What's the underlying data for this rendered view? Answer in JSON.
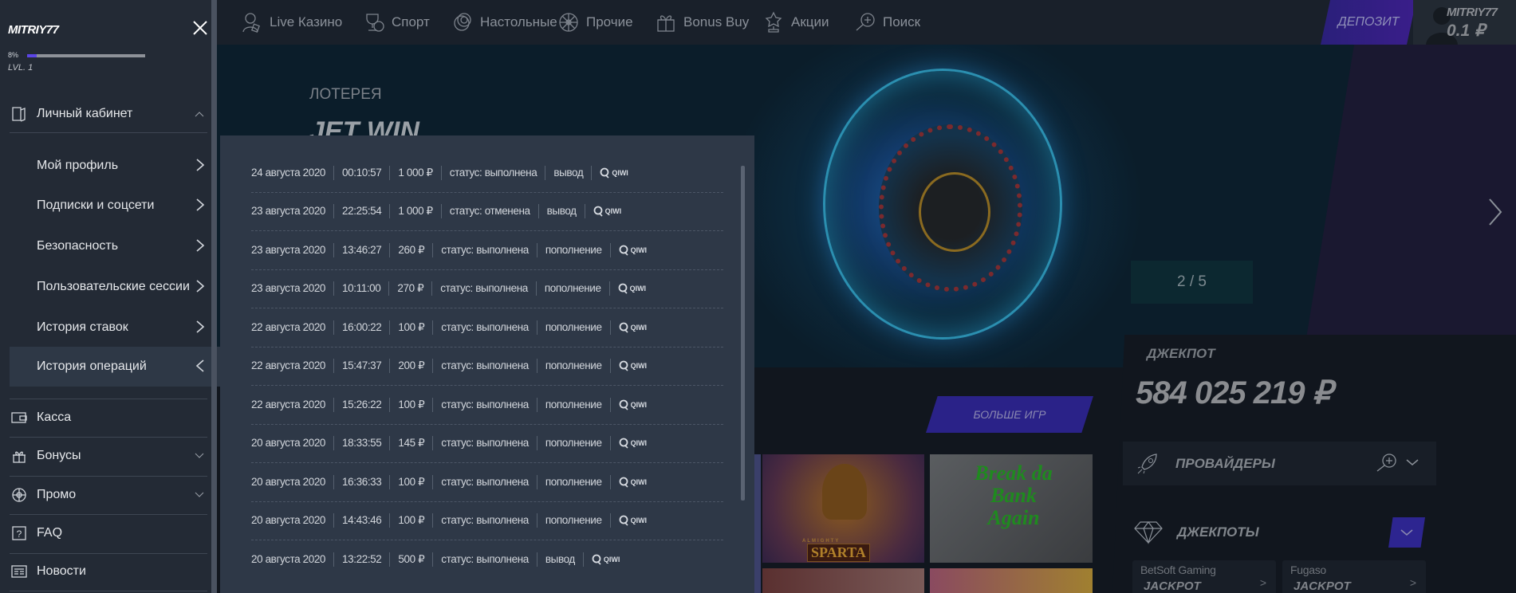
{
  "topbar": {
    "nav": [
      {
        "label": "Live Казино",
        "icon": "live-dealer-icon"
      },
      {
        "label": "Спорт",
        "icon": "trophy-ball-icon"
      },
      {
        "label": "Настольные",
        "icon": "chips-icon"
      },
      {
        "label": "Прочие",
        "icon": "wheel-icon"
      },
      {
        "label": "Bonus Buy",
        "icon": "gift-icon"
      },
      {
        "label": "Акции",
        "icon": "star-award-icon"
      },
      {
        "label": "Поиск",
        "icon": "search-plus-icon"
      }
    ],
    "deposit_label": "ДЕПОЗИТ",
    "user_name": "MITRIY77",
    "balance": "0.1 ₽"
  },
  "banner": {
    "category": "ЛОТЕРЕЯ",
    "title": "JET WIN",
    "slide_counter": "2 / 5"
  },
  "jackpot": {
    "label": "ДЖЕКПОТ",
    "amount": "584 025 219 ₽"
  },
  "providers": {
    "title": "ПРОВАЙДЕРЫ"
  },
  "jackpots": {
    "title": "ДЖЕКПОТЫ",
    "cards": [
      {
        "provider": "BetSoft Gaming",
        "label": "JACKPOT"
      },
      {
        "provider": "Fugaso",
        "label": "JACKPOT"
      }
    ]
  },
  "games": {
    "more_label": "БОЛЬШЕ ИГР",
    "tiles": [
      {
        "title": "SPARTA",
        "subtitle": "ALMIGHTY"
      },
      {
        "title": "Break da Bank Again"
      }
    ]
  },
  "sidebar": {
    "user_name": "MITRIY77",
    "progress_percent": 8,
    "progress_label": "8%",
    "level": "LVL. 1",
    "account": {
      "label": "Личный кабинет",
      "sub": [
        "Мой профиль",
        "Подписки и соцсети",
        "Безопасность",
        "Пользовательские сессии",
        "История ставок",
        "История операций"
      ]
    },
    "items": [
      {
        "label": "Касса",
        "icon": "wallet-icon"
      },
      {
        "label": "Бонусы",
        "icon": "gift-icon"
      },
      {
        "label": "Промо",
        "icon": "promo-wheel-icon"
      },
      {
        "label": "FAQ",
        "icon": "question-icon"
      },
      {
        "label": "Новости",
        "icon": "news-icon"
      }
    ]
  },
  "operations": [
    {
      "date": "24 августа 2020",
      "time": "00:10:57",
      "amount": "1 000 ₽",
      "status": "статус: выполнена",
      "type": "вывод",
      "method": "QIWI"
    },
    {
      "date": "23 августа 2020",
      "time": "22:25:54",
      "amount": "1 000 ₽",
      "status": "статус: отменена",
      "type": "вывод",
      "method": "QIWI"
    },
    {
      "date": "23 августа 2020",
      "time": "13:46:27",
      "amount": "260 ₽",
      "status": "статус: выполнена",
      "type": "пополнение",
      "method": "QIWI"
    },
    {
      "date": "23 августа 2020",
      "time": "10:11:00",
      "amount": "270 ₽",
      "status": "статус: выполнена",
      "type": "пополнение",
      "method": "QIWI"
    },
    {
      "date": "22 августа 2020",
      "time": "16:00:22",
      "amount": "100 ₽",
      "status": "статус: выполнена",
      "type": "пополнение",
      "method": "QIWI"
    },
    {
      "date": "22 августа 2020",
      "time": "15:47:37",
      "amount": "200 ₽",
      "status": "статус: выполнена",
      "type": "пополнение",
      "method": "QIWI"
    },
    {
      "date": "22 августа 2020",
      "time": "15:26:22",
      "amount": "100 ₽",
      "status": "статус: выполнена",
      "type": "пополнение",
      "method": "QIWI"
    },
    {
      "date": "20 августа 2020",
      "time": "18:33:55",
      "amount": "145 ₽",
      "status": "статус: выполнена",
      "type": "пополнение",
      "method": "QIWI"
    },
    {
      "date": "20 августа 2020",
      "time": "16:36:33",
      "amount": "100 ₽",
      "status": "статус: выполнена",
      "type": "пополнение",
      "method": "QIWI"
    },
    {
      "date": "20 августа 2020",
      "time": "14:43:46",
      "amount": "100 ₽",
      "status": "статус: выполнена",
      "type": "пополнение",
      "method": "QIWI"
    },
    {
      "date": "20 августа 2020",
      "time": "13:22:52",
      "amount": "500 ₽",
      "status": "статус: выполнена",
      "type": "вывод",
      "method": "QIWI"
    }
  ],
  "colors": {
    "accent": "#5b45e6",
    "deposit": "#2d2590",
    "panel": "#2e3847",
    "sidebar": "#232a35"
  }
}
